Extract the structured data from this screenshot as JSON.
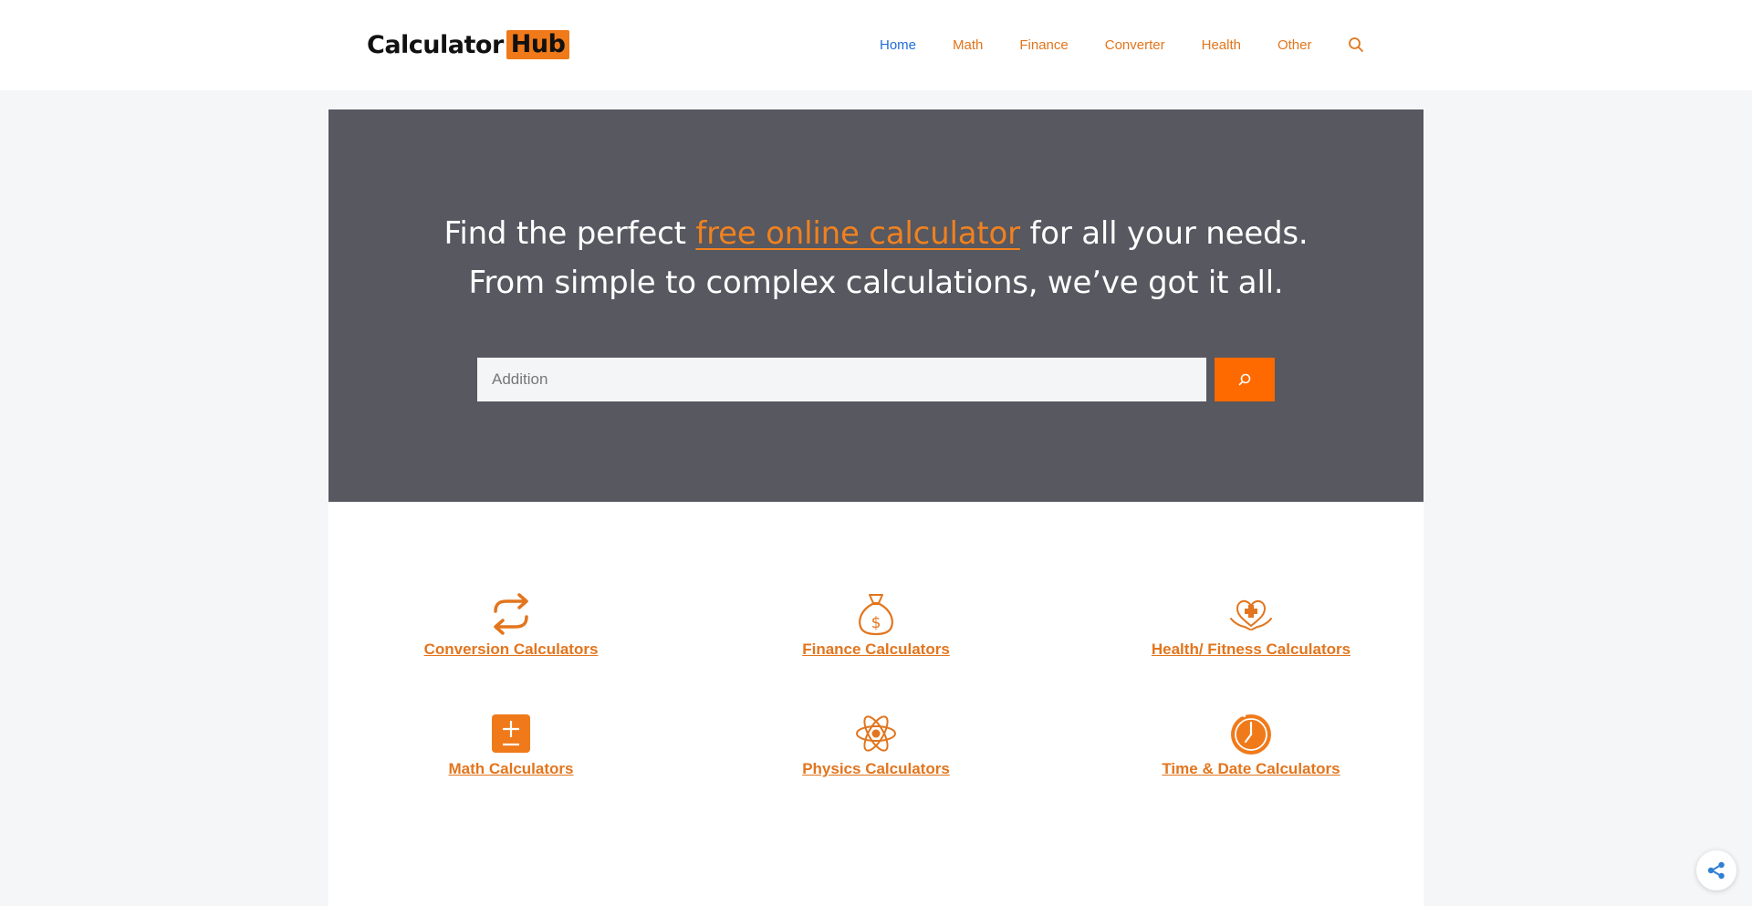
{
  "header": {
    "logo": {
      "text": "Calculator",
      "highlight": "Hub"
    },
    "nav": [
      {
        "label": "Home",
        "active": true
      },
      {
        "label": "Math"
      },
      {
        "label": "Finance"
      },
      {
        "label": "Converter"
      },
      {
        "label": "Health"
      },
      {
        "label": "Other"
      }
    ],
    "search_icon": "search-icon"
  },
  "hero": {
    "line1_before": "Find the perfect ",
    "line1_link": "free online calculator",
    "line1_after": " for all your needs.",
    "line2": "From simple to complex calculations, we’ve got it all.",
    "search": {
      "value": "Addition",
      "placeholder": "Addition",
      "button_icon": "search-icon"
    }
  },
  "categories": [
    {
      "label": "Conversion Calculators",
      "icon": "conversion-arrows-icon"
    },
    {
      "label": "Finance Calculators",
      "icon": "money-bag-icon"
    },
    {
      "label": "Health/ Fitness Calculators",
      "icon": "heart-hands-icon"
    },
    {
      "label": "Math Calculators",
      "icon": "plus-minus-icon"
    },
    {
      "label": "Physics Calculators",
      "icon": "atom-icon"
    },
    {
      "label": "Time & Date Calculators",
      "icon": "clock-icon"
    }
  ],
  "share_icon": "share-icon",
  "colors": {
    "accent": "#e2751d",
    "button": "#ff6a00",
    "hero_bg": "#575860",
    "active_nav": "#1e6fd9"
  }
}
